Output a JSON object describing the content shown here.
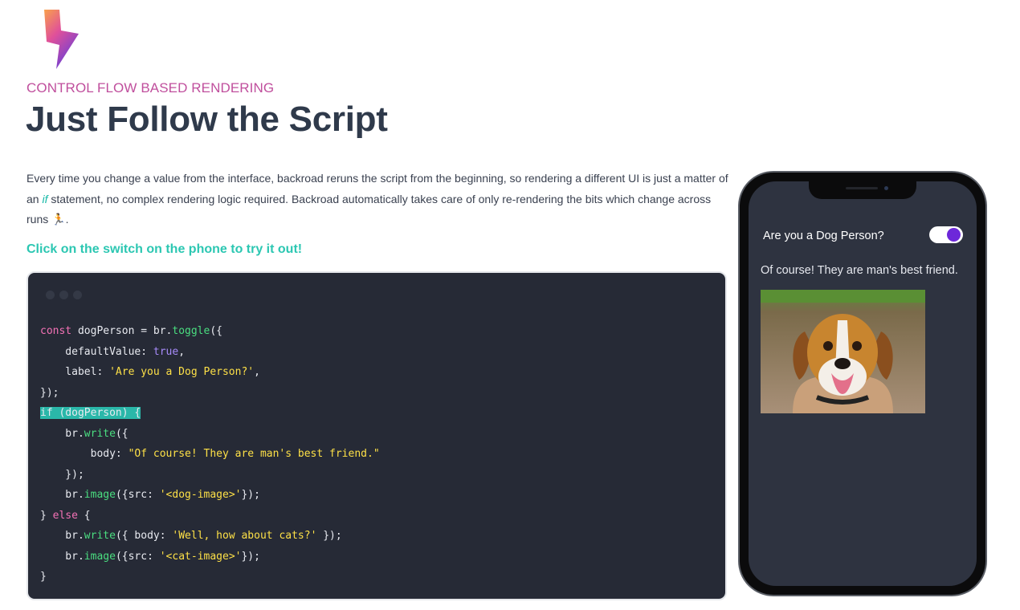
{
  "header": {
    "eyebrow": "CONTROL FLOW BASED RENDERING",
    "title": "Just Follow the Script"
  },
  "description": {
    "part1": "Every time you change a value from the interface, backroad reruns the script from the beginning, so rendering a different UI is just a matter of an ",
    "keyword": "if",
    "part2": " statement, no complex rendering logic required. Backroad automatically takes care of only re-rendering the bits which change across runs ",
    "emoji": "🏃"
  },
  "cta": "Click on the switch on the phone to try it out!",
  "code": {
    "l1": {
      "a": "const",
      "b": " dogPerson = br.",
      "c": "toggle",
      "d": "({"
    },
    "l2": {
      "a": "    defaultValue: ",
      "b": "true",
      "c": ","
    },
    "l3": {
      "a": "    label: ",
      "b": "'Are you a Dog Person?'",
      "c": ","
    },
    "l4": "});",
    "l5": {
      "a": "if",
      "b": " (dogPerson) {"
    },
    "l6": {
      "a": "    br.",
      "b": "write",
      "c": "({"
    },
    "l7": {
      "a": "        body: ",
      "b": "\"Of course! They are man's best friend.\""
    },
    "l8": "    });",
    "l9": {
      "a": "    br.",
      "b": "image",
      "c": "({src: ",
      "d": "'<dog-image>'",
      "e": "});"
    },
    "l10": {
      "a": "} ",
      "b": "else",
      "c": " {"
    },
    "l11": {
      "a": "    br.",
      "b": "write",
      "c": "({ body: ",
      "d": "'Well, how about cats?'",
      "e": " });"
    },
    "l12": {
      "a": "    br.",
      "b": "image",
      "c": "({src: ",
      "d": "'<cat-image>'",
      "e": "});"
    },
    "l13": "}"
  },
  "phone": {
    "toggle_label": "Are you a Dog Person?",
    "toggle_on": true,
    "text": "Of course! They are man's best friend."
  },
  "colors": {
    "accent_pink": "#c04f9d",
    "accent_teal": "#2cc7b2",
    "toggle_knob": "#6d28d9",
    "code_bg": "#262a36",
    "phone_screen": "#2e3340"
  }
}
